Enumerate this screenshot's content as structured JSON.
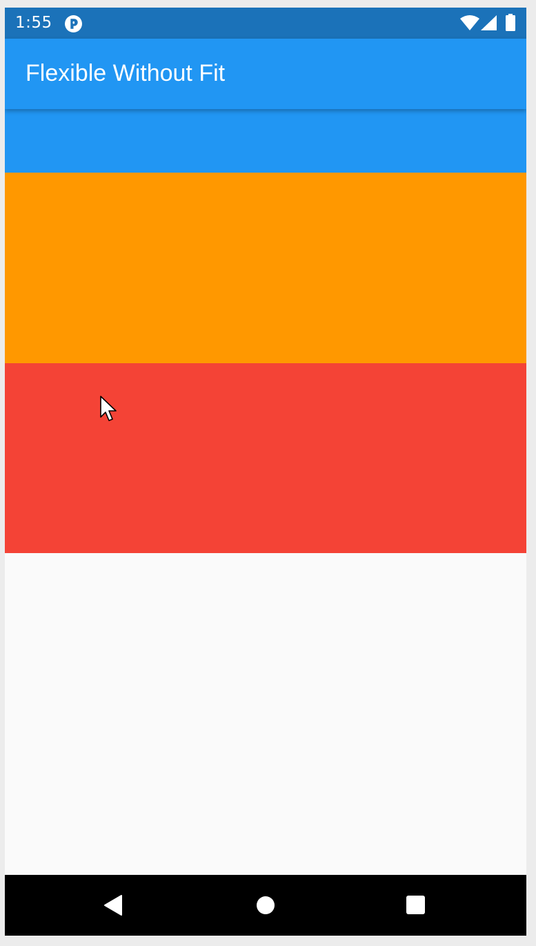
{
  "status_bar": {
    "time": "1:55",
    "app_icon": "pocket-p-icon",
    "wifi_icon": "wifi-icon",
    "signal_icon": "cell-signal-icon",
    "battery_icon": "battery-full-icon",
    "background_color": "#1b72b9"
  },
  "app_bar": {
    "title": "Flexible Without Fit",
    "color": "#2196f3"
  },
  "blocks": [
    {
      "name": "blue",
      "color": "#2196f3"
    },
    {
      "name": "orange",
      "color": "#ff9800"
    },
    {
      "name": "red",
      "color": "#f44336"
    }
  ],
  "background_color": "#fafafa",
  "nav_bar": {
    "back_icon": "back-triangle-icon",
    "home_icon": "home-circle-icon",
    "recents_icon": "recents-square-icon"
  }
}
